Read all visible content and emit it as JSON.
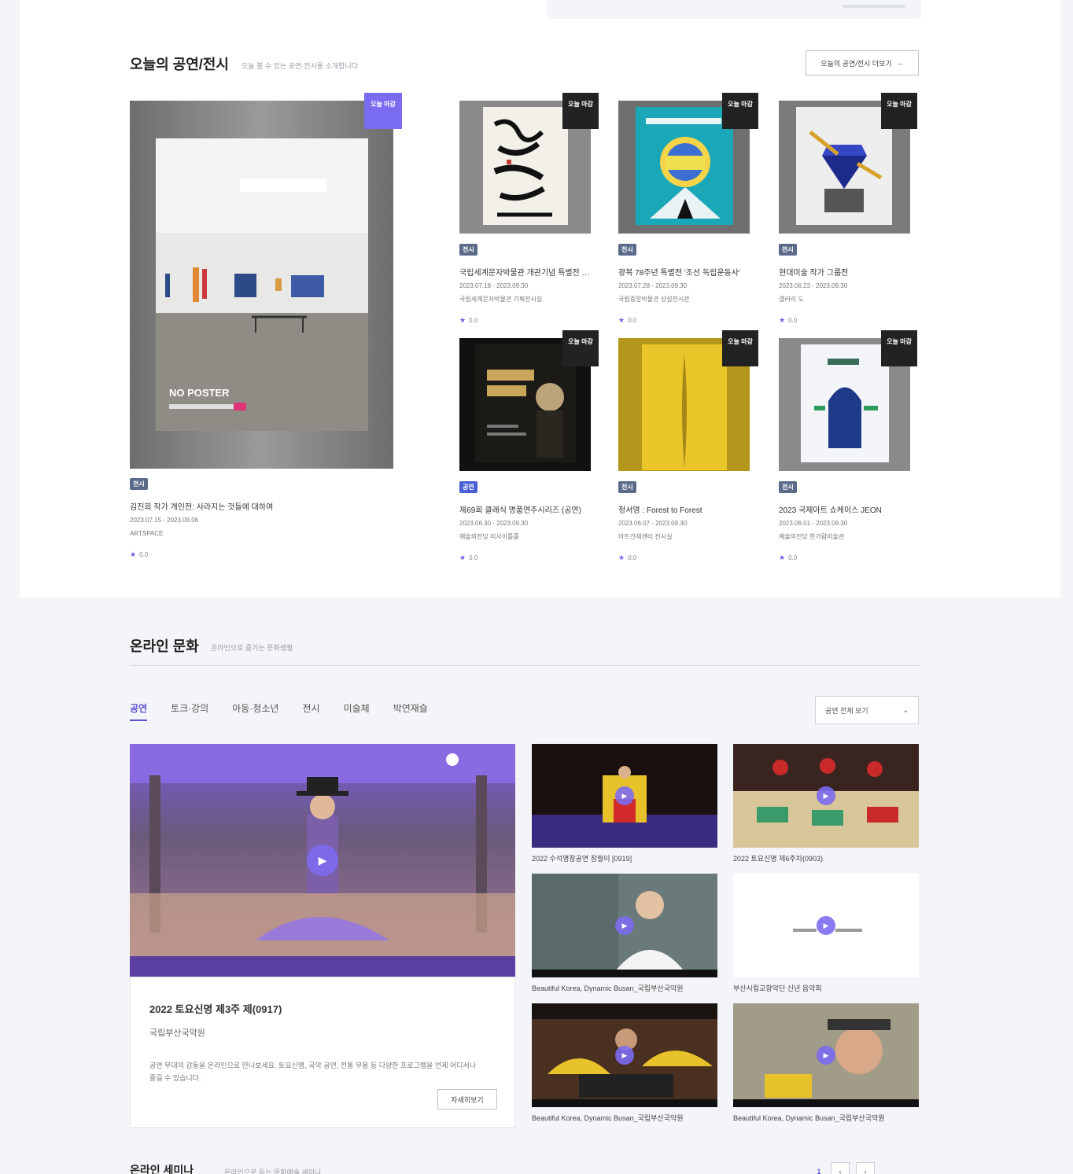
{
  "today": {
    "title": "오늘의 공연/전시",
    "subtitle": "오늘 볼 수 있는 공연·전시를 소개합니다",
    "more_label": "오늘의 공연/전시 더보기",
    "more_icon": "arrow-right-icon",
    "featured": {
      "badge": "오늘 마감",
      "poster_text": "NO POSTER",
      "tag": "전시",
      "title": "김진희 작가 개인전: 사라지는 것들에 대하여",
      "date": "2023.07.15 - 2023.08.06",
      "venue": "ARTSPACE",
      "rating": "0.0"
    },
    "cards": [
      {
        "badge": "오늘 마감",
        "tag": "전시",
        "title": "국립세계문자박물관 개관기념 특별전 - 문자로 이어진 세상",
        "date": "2023.07.18 - 2023.09.30",
        "venue": "국립세계문자박물관 기획전시실",
        "rating": "0.0"
      },
      {
        "badge": "오늘 마감",
        "tag": "전시",
        "title": "광복 78주년 특별전 '조선 독립운동사'",
        "date": "2023.07.28 - 2023.09.30",
        "venue": "국립중앙박물관 상설전시관",
        "rating": "0.0"
      },
      {
        "badge": "오늘 마감",
        "tag": "전시",
        "title": "현대미술 작가 그룹전",
        "date": "2023.06.23 - 2023.09.30",
        "venue": "갤러리 도",
        "rating": "0.0"
      },
      {
        "badge": "오늘 마감",
        "tag": "공연",
        "title": "제69회 클래식 명품연주시리즈 (공연)",
        "date": "2023.06.30 - 2023.09.30",
        "venue": "예술의전당 리사이틀홀",
        "rating": "0.0"
      },
      {
        "badge": "오늘 마감",
        "tag": "전시",
        "title": "정서영 : Forest to Forest",
        "date": "2023.06.07 - 2023.09.30",
        "venue": "아트선재센터 전시실",
        "rating": "0.0"
      },
      {
        "badge": "오늘 마감",
        "tag": "전시",
        "title": "2023 국제아트 쇼케이스 JEON",
        "date": "2023.06.01 - 2023.09.30",
        "venue": "예술의전당 한가람미술관",
        "rating": "0.0"
      }
    ]
  },
  "online": {
    "title": "온라인 문화",
    "subtitle": "온라인으로 즐기는 문화생활",
    "tabs": [
      "공연",
      "토크·강의",
      "아동·청소년",
      "전시",
      "미술체",
      "박연재슬"
    ],
    "select_label": "공연 전체 보기",
    "select_icon": "chevron-down-icon",
    "main": {
      "play_icon": "play-icon",
      "title": "2022 토요신명 제3주 제(0917)",
      "subtitle": "국립부산국악원",
      "desc": "공연 무대의 감동을 온라인으로 만나보세요. 토요신명, 국악 공연, 전통 무용 등 다양한 프로그램을 언제 어디서나 즐길 수 있습니다.",
      "button": "자세히보기"
    },
    "thumbs": [
      {
        "caption": "2022 수석명창공연 장월이 [0919]"
      },
      {
        "caption": "2022 토요신명 제6주차(0903)"
      },
      {
        "caption": "Beautiful Korea, Dynamic Busan_국립부산국악원"
      },
      {
        "caption": "부산시립교향악단 신년 음악회"
      },
      {
        "caption": "Beautiful Korea, Dynamic Busan_국립부산국악원"
      },
      {
        "caption": "Beautiful Korea, Dynamic Busan_국립부산국악원"
      }
    ]
  },
  "next_section": {
    "title": "온라인 세미나",
    "subtitle": "온라인으로 듣는 문화예술 세미나",
    "page": "1",
    "pager": [
      "‹",
      "›"
    ]
  },
  "colors": {
    "accent": "#6c5ce7",
    "badge_dark": "#222222",
    "badge_purple": "#7a6cf0"
  }
}
